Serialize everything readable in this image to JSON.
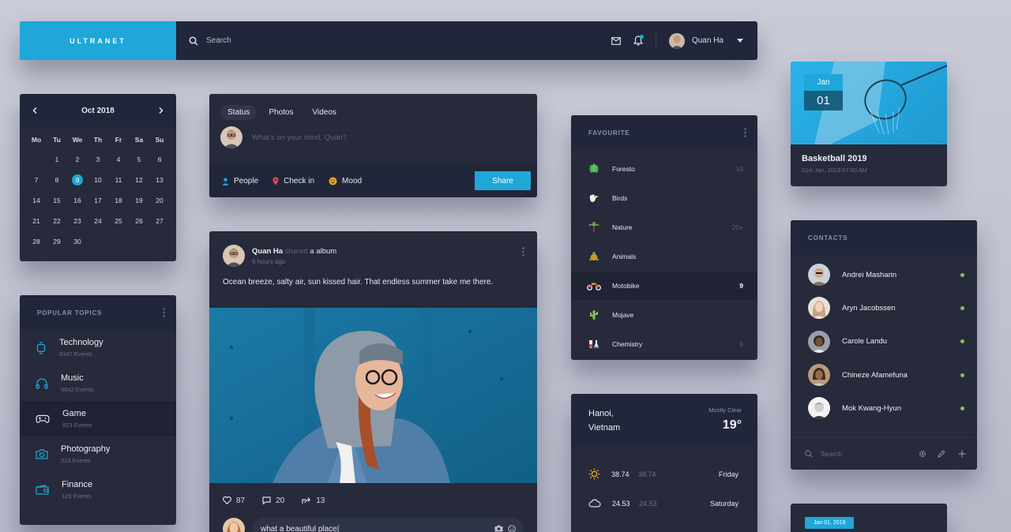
{
  "topbar": {
    "brand": "ULTRANET",
    "search_placeholder": "Search",
    "user_name": "Quan Ha"
  },
  "calendar": {
    "month_label": "Oct 2018",
    "weekdays": [
      "Mo",
      "Tu",
      "We",
      "Th",
      "Fr",
      "Sa",
      "Su"
    ],
    "days": [
      "",
      "1",
      "2",
      "3",
      "4",
      "5",
      "6",
      "7",
      "8",
      "9",
      "10",
      "11",
      "12",
      "13",
      "14",
      "15",
      "16",
      "17",
      "18",
      "19",
      "20",
      "21",
      "22",
      "23",
      "24",
      "25",
      "26",
      "27",
      "28",
      "29",
      "30"
    ],
    "selected_day": "9"
  },
  "topics": {
    "title": "POPULAR TOPICS",
    "items": [
      {
        "name": "Technology",
        "events": "8347 Events",
        "icon": "watch-icon"
      },
      {
        "name": "Music",
        "events": "5842 Events",
        "icon": "headphones-icon"
      },
      {
        "name": "Game",
        "events": "823 Events",
        "icon": "gamepad-icon"
      },
      {
        "name": "Photography",
        "events": "523 Events",
        "icon": "camera-icon"
      },
      {
        "name": "Finance",
        "events": "126 Events",
        "icon": "wallet-icon"
      }
    ]
  },
  "composer": {
    "tabs": [
      "Status",
      "Photos",
      "Videos"
    ],
    "placeholder": "What's on your mind, Quan?",
    "actions": [
      "People",
      "Check in",
      "Mood"
    ],
    "share_label": "Share"
  },
  "post": {
    "author": "Quan Ha",
    "shared_word": "shared",
    "object": "a album",
    "time": "6 hours ago",
    "text": "Ocean breeze, salty air, sun kissed hair. That endless summer take me there.",
    "likes": "87",
    "comments": "20",
    "shares": "13",
    "comment_value": "what a beautiful place|"
  },
  "favourite": {
    "title": "FAVOURITE",
    "items": [
      {
        "label": "Foresto",
        "count": "15",
        "icon": "tree-icon"
      },
      {
        "label": "Birds",
        "count": "",
        "icon": "bird-icon"
      },
      {
        "label": "Nature",
        "count": "20+",
        "icon": "palm-icon"
      },
      {
        "label": "Animals",
        "count": "",
        "icon": "turtle-icon"
      },
      {
        "label": "Motobike",
        "count": "9",
        "icon": "motorbike-icon"
      },
      {
        "label": "Mojave",
        "count": "",
        "icon": "cactus-icon"
      },
      {
        "label": "Chemistry",
        "count": "9",
        "icon": "flask-icon"
      }
    ]
  },
  "weather": {
    "city": "Hanoi,",
    "country": "Vietnam",
    "condition": "Mostly Clear",
    "temp": "19°",
    "forecast": [
      {
        "hi": "38.74",
        "lo": "38.74",
        "day": "Friday",
        "icon": "sun-icon"
      },
      {
        "hi": "24.53",
        "lo": "24.53",
        "day": "Saturday",
        "icon": "cloud-icon"
      }
    ]
  },
  "event": {
    "month": "Jan",
    "day": "01",
    "title": "Basketball 2019",
    "time": "01st Jan, 2019 07:00 AM"
  },
  "contacts": {
    "title": "CONTACTS",
    "people": [
      "Andrei Masharin",
      "Aryn Jacobssen",
      "Carole Landu",
      "Chineze Afamefuna",
      "Mok Kwang-Hyun"
    ],
    "search_placeholder": "Search"
  },
  "date_card": {
    "pill": "Jan 01, 2019"
  },
  "colors": {
    "accent": "#1ea7d8",
    "panel": "#262a3a",
    "panel_header": "#22263a",
    "online": "#8bc34a"
  }
}
